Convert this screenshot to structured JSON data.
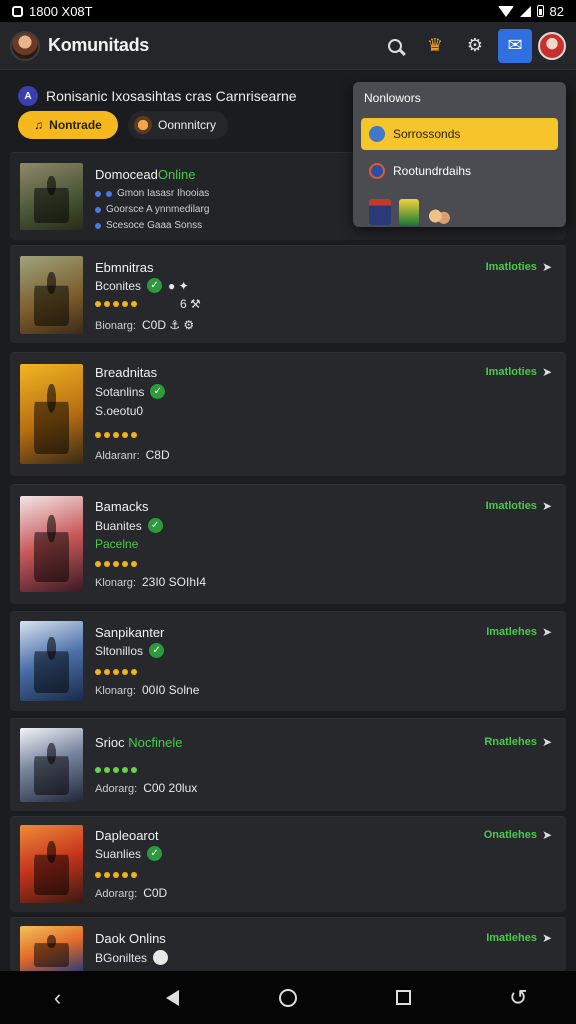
{
  "status_bar": {
    "time": "1800 X08T",
    "right_text": "82"
  },
  "header": {
    "title": "Komunitads"
  },
  "subheader": {
    "icon_letter": "A",
    "text": "Ronisanic Ixosasihtas cras Carnrisearne"
  },
  "chips": {
    "primary": "Nontrade",
    "secondary": "Oonnnitcry"
  },
  "dropdown": {
    "title": "Nonlowors",
    "items": [
      {
        "label": "Sorrossonds",
        "active": true
      },
      {
        "label": "Rootundrdaihs",
        "active": false
      }
    ]
  },
  "featured": {
    "name": "Domocead",
    "name_suffix": "Online",
    "detail_lines": [
      "Gmon  Iasasr Ihooias",
      "Goorsce A ynnmedilarg",
      "Scesoce Gaaa  Sonss"
    ]
  },
  "cards": [
    {
      "name": "Ebmnitras",
      "line2": "Bconites",
      "line2_icon": "check",
      "extra": "● ✦",
      "line3": "6  ⚒",
      "line3_green": false,
      "stars": 5,
      "stars_green": false,
      "meta_label": "Bionarg:",
      "meta_value": "C0D  ⚓ ⚙",
      "status": "Imatloties"
    },
    {
      "name": "Breadnitas",
      "line2": "Sotanlins",
      "line2_icon": "check",
      "extra": "",
      "line3": "S.oeotu0",
      "line3_green": false,
      "stars": 5,
      "stars_green": false,
      "meta_label": "Aldaranr:",
      "meta_value": "C8D",
      "status": "Imatloties"
    },
    {
      "name": "Bamacks",
      "line2": "Buanites",
      "line2_icon": "check",
      "extra": "",
      "line3": "Pacelne",
      "line3_green": true,
      "stars": 5,
      "stars_green": false,
      "meta_label": "Klonarg:",
      "meta_value": "23I0  SOIhI4",
      "status": "Imatloties"
    },
    {
      "name": "Sanpikanter",
      "line2": "Sltonillos",
      "line2_icon": "check",
      "extra": "",
      "line3": "",
      "line3_green": false,
      "stars": 5,
      "stars_green": false,
      "meta_label": "Klonarg:",
      "meta_value": "00I0  Solne",
      "status": "Imatlehes"
    },
    {
      "name": "Srioc",
      "name_green": "Nocfinele",
      "line2": "",
      "line2_icon": "",
      "extra": "",
      "line3": "",
      "line3_green": false,
      "stars": 5,
      "stars_green": true,
      "meta_label": "Adorarg:",
      "meta_value": "C00  20lux",
      "status": "Rnatlehes"
    },
    {
      "name": "Dapleoarot",
      "line2": "Suanlies",
      "line2_icon": "check",
      "extra": "",
      "line3": "",
      "line3_green": false,
      "stars": 5,
      "stars_green": false,
      "meta_label": "Adorarg:",
      "meta_value": "C0D",
      "status": "Onatlehes"
    },
    {
      "name": "Daok Onlins",
      "line2": "BGoniltes",
      "line2_icon": "pending",
      "extra": "",
      "line3": "",
      "line3_green": false,
      "stars": 0,
      "stars_green": false,
      "meta_label": "",
      "meta_value": "",
      "status": "Imatlehes"
    }
  ],
  "colors": {
    "accent_yellow": "#f6b91d",
    "online_green": "#4bc94b",
    "mail_blue": "#2f6fe0"
  }
}
